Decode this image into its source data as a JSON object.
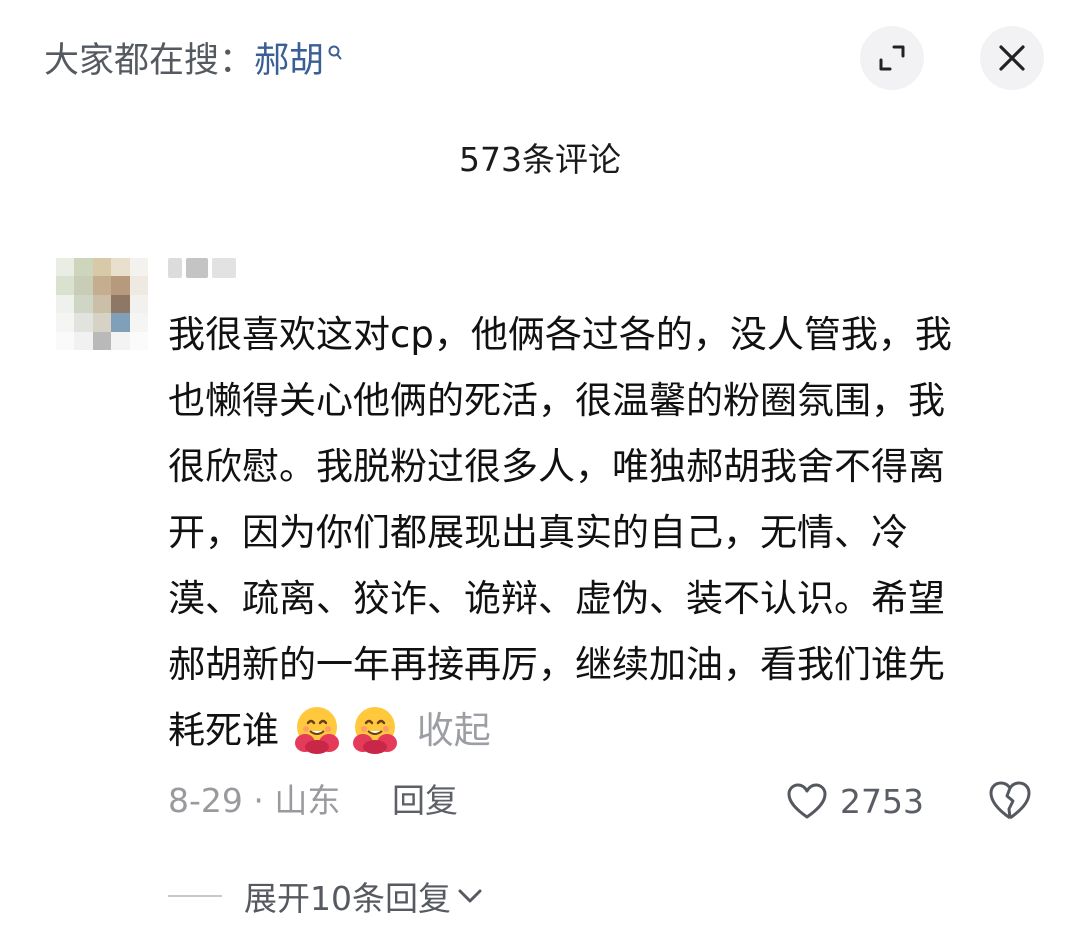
{
  "header": {
    "search_prefix": "大家都在搜：",
    "search_keyword": "郝胡",
    "expand_icon": "expand-icon",
    "close_icon": "close-icon"
  },
  "comments_title": "573条评论",
  "comment": {
    "text_lines": [
      "我很喜欢这对cp，他俩各过各的，没人管我，我",
      "也懒得关心他俩的死活，很温馨的粉圈氛围，我",
      "很欣慰。我脱粉过很多人，唯独郝胡我舍不得离",
      "开，因为你们都展现出真实的自己，无情、冷",
      "漠、疏离、狡诈、诡辩、虚伪、装不认识。希望",
      "郝胡新的一年再接再厉，继续加油，看我们谁先"
    ],
    "last_line": "耗死谁",
    "emojis": [
      "hugging-face-emoji",
      "hugging-face-emoji"
    ],
    "collapse_label": "收起",
    "date_location": "8-29 · 山东",
    "reply_label": "回复",
    "like_count": "2753",
    "expand_replies_label": "展开10条回复"
  },
  "colors": {
    "keyword": "#3a5f95",
    "muted": "#9a9a9e",
    "text": "#111111"
  }
}
